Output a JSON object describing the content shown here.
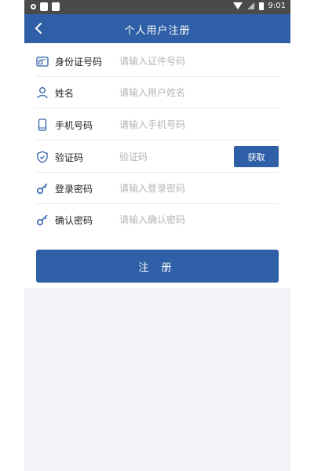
{
  "status_bar": {
    "time": "9:01"
  },
  "header": {
    "title": "个人用户注册",
    "back_icon": "chevron-left-icon"
  },
  "form": {
    "rows": [
      {
        "label": "身份证号码",
        "placeholder": "请输入证件号码",
        "icon": "id-card-icon"
      },
      {
        "label": "姓名",
        "placeholder": "请输入用户姓名",
        "icon": "user-icon"
      },
      {
        "label": "手机号码",
        "placeholder": "请输入手机号码",
        "icon": "phone-icon"
      },
      {
        "label": "验证码",
        "placeholder": "验证码",
        "icon": "shield-check-icon",
        "button": "获取"
      },
      {
        "label": "登录密码",
        "placeholder": "请输入登录密码",
        "icon": "key-icon"
      },
      {
        "label": "确认密码",
        "placeholder": "请输入确认密码",
        "icon": "key-icon"
      }
    ],
    "submit_label": "注 册"
  },
  "colors": {
    "primary": "#2f5fa6",
    "status_bar": "#4a4a4a",
    "background": "#f2f2f7"
  }
}
